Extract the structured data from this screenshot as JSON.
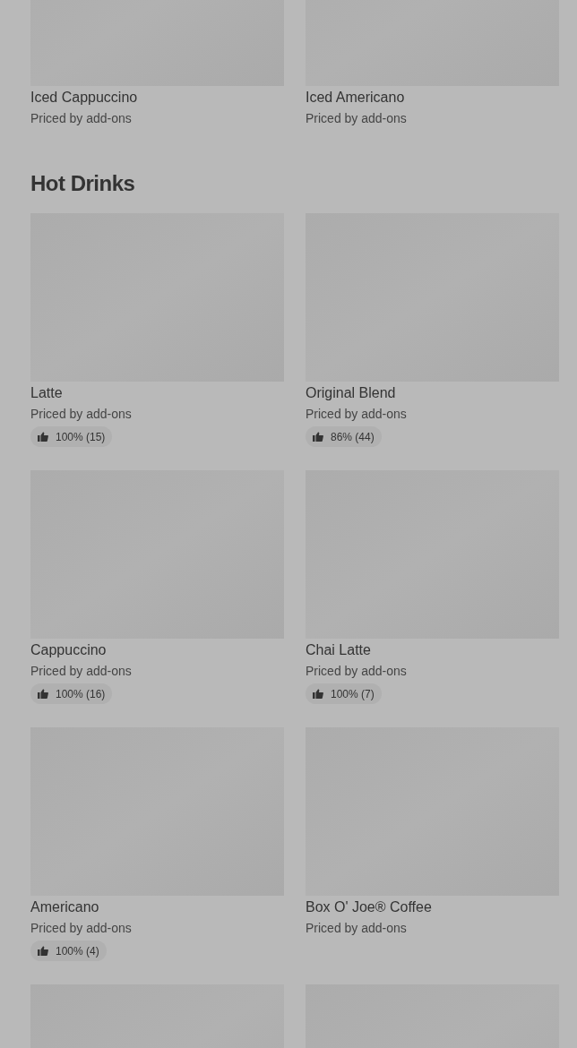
{
  "sections": [
    {
      "items": [
        {
          "kind": "card",
          "name": "Iced Cappuccino",
          "subtitle": "Priced by add-ons"
        },
        {
          "kind": "card",
          "name": "Iced Americano",
          "subtitle": "Priced by add-ons"
        }
      ]
    },
    {
      "title": "Hot Drinks",
      "items": [
        {
          "kind": "card",
          "name": "Latte",
          "subtitle": "Priced by add-ons",
          "rating": "100% (15)"
        },
        {
          "kind": "card",
          "name": "Original Blend",
          "subtitle": "Priced by add-ons",
          "rating": "86% (44)"
        },
        {
          "kind": "card",
          "name": "Cappuccino",
          "subtitle": "Priced by add-ons",
          "rating": "100% (16)"
        },
        {
          "kind": "card",
          "name": "Chai Latte",
          "subtitle": "Priced by add-ons",
          "rating": "100% (7)"
        },
        {
          "kind": "card",
          "name": "Americano",
          "subtitle": "Priced by add-ons",
          "rating": "100% (4)"
        },
        {
          "kind": "card",
          "name": "Box O' Joe® Coffee",
          "subtitle": "Priced by add-ons"
        },
        {
          "kind": "image_only"
        },
        {
          "kind": "image_only"
        }
      ]
    }
  ]
}
